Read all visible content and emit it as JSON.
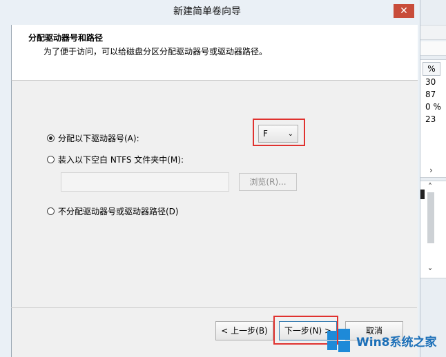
{
  "window": {
    "title": "新建简单卷向导",
    "close_glyph": "✕"
  },
  "header": {
    "title": "分配驱动器号和路径",
    "subtitle": "为了便于访问，可以给磁盘分区分配驱动器号或驱动器路径。"
  },
  "options": {
    "assign_letter": {
      "label": "分配以下驱动器号(A):",
      "checked": true
    },
    "mount_folder": {
      "label": "装入以下空白 NTFS 文件夹中(M):",
      "checked": false
    },
    "no_assign": {
      "label": "不分配驱动器号或驱动器路径(D)",
      "checked": false
    }
  },
  "drive_select": {
    "value": "F"
  },
  "path_input": {
    "value": ""
  },
  "browse_button": {
    "label": "浏览(R)..."
  },
  "buttons": {
    "back": "< 上一步(B)",
    "next": "下一步(N) >",
    "cancel": "取消"
  },
  "background_window": {
    "column_header": "%",
    "values": [
      "30",
      "87",
      "0 %",
      "23"
    ]
  },
  "watermark": {
    "text": "Win8系统之家"
  },
  "colors": {
    "highlight": "#e0322f",
    "close": "#c84c3a",
    "brand": "#1e8ad8"
  }
}
